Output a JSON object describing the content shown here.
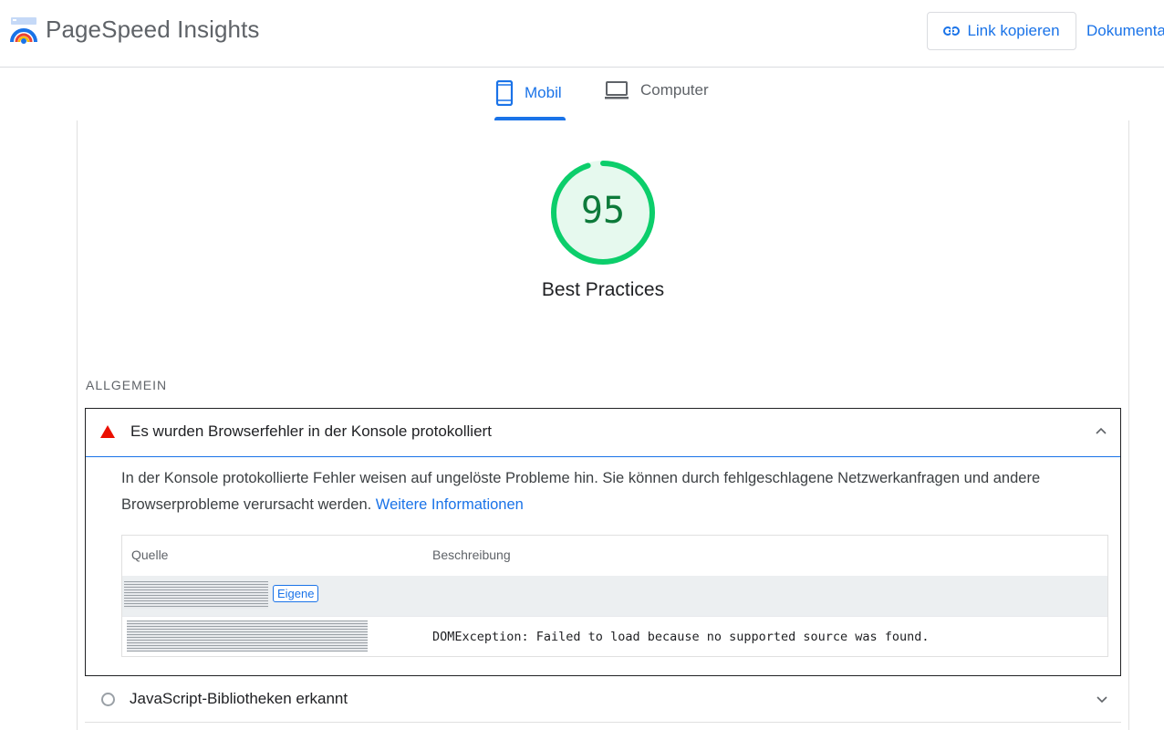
{
  "header": {
    "brand": "PageSpeed Insights",
    "copy_link_label": "Link kopieren",
    "docs_label": "Dokumenta",
    "icons": [
      "pagespeed-logo-icon",
      "link-icon"
    ]
  },
  "tabs": [
    {
      "label": "Mobil",
      "icon": "smartphone-icon",
      "selected": true
    },
    {
      "label": "Computer",
      "icon": "laptop-icon",
      "selected": false
    }
  ],
  "score": {
    "value": "95",
    "fraction": 0.95,
    "label": "Best Practices",
    "color": "#0cce6b"
  },
  "section": {
    "title": "ALLGEMEIN"
  },
  "audits": [
    {
      "title": "Es wurden Browserfehler in der Konsole protokolliert",
      "status": "fail",
      "status_icon": "warning-triangle-icon",
      "expanded": true,
      "description": "In der Konsole protokollierte Fehler weisen auf ungelöste Probleme hin. Sie können durch fehlgeschlagene Netzwerkanfragen und andere Browserprobleme verursacht werden.",
      "learn_more": "Weitere Informationen",
      "table": {
        "headers": [
          "Quelle",
          "Beschreibung"
        ],
        "rows": [
          {
            "source_badge": "Eigene",
            "description": ""
          },
          {
            "source_badge": "",
            "description": "DOMException: Failed to load because no supported source was found."
          }
        ]
      }
    },
    {
      "title": "JavaScript-Bibliotheken erkannt",
      "status": "info",
      "status_icon": "circle-icon",
      "expanded": false
    }
  ],
  "colors": {
    "accent": "#1a73e8",
    "pass": "#0cce6b",
    "fail": "#eb0f00"
  }
}
